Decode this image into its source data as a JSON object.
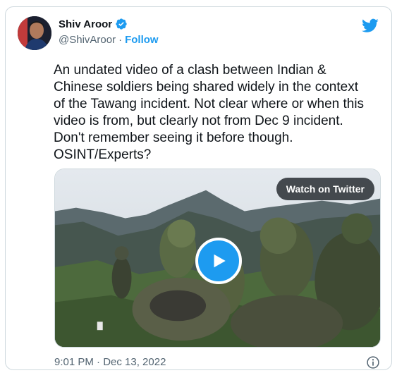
{
  "author": {
    "display_name": "Shiv Aroor",
    "handle": "@ShivAroor",
    "separator": "·",
    "follow_label": "Follow"
  },
  "tweet": {
    "text": "An undated video of a clash between Indian &\nChinese soldiers being shared widely in the context\nof the Tawang incident. Not clear where or when this\nvideo is from, but clearly not from Dec 9 incident.\nDon't remember seeing it before though.\nOSINT/Experts?",
    "timestamp": "9:01 PM · Dec 13, 2022"
  },
  "media": {
    "watch_label": "Watch on Twitter"
  },
  "icons": {
    "verified": "verified-badge-icon",
    "bird": "twitter-bird-icon",
    "play": "play-icon",
    "info": "info-icon"
  },
  "colors": {
    "brand_blue": "#1d9bf0",
    "text": "#0f1419",
    "secondary_text": "#536471",
    "border": "#cfd9de"
  }
}
